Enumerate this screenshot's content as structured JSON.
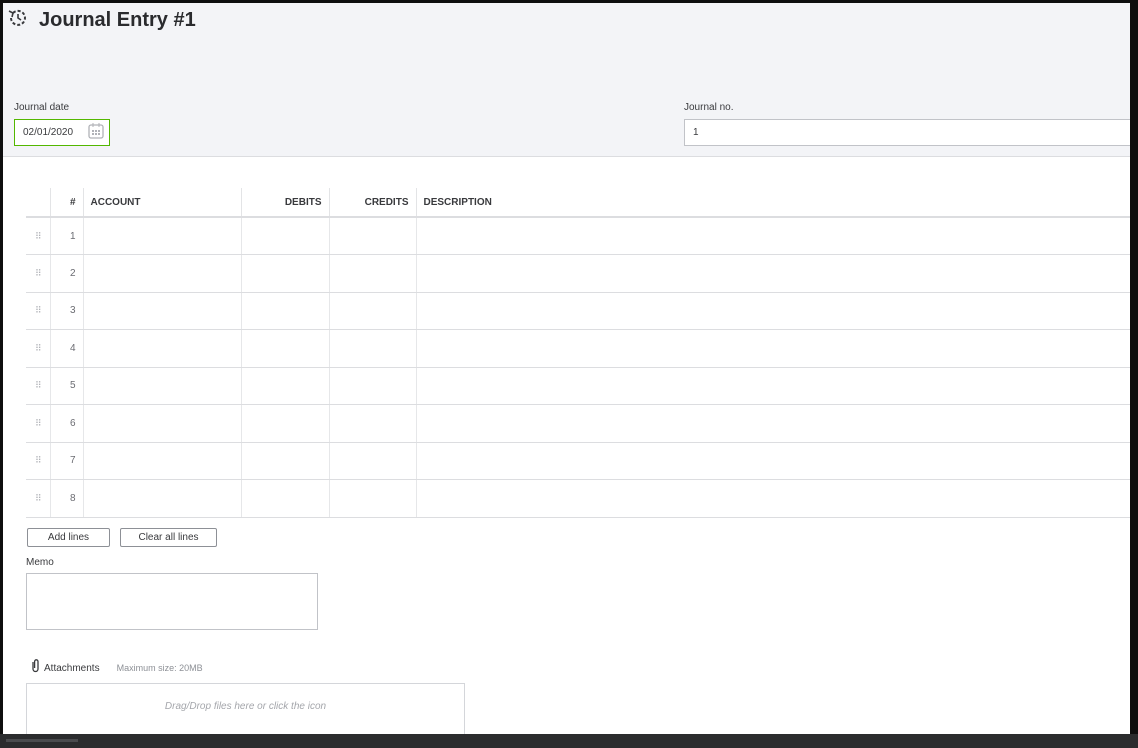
{
  "header": {
    "title": "Journal Entry #1",
    "icon": "recent-history-icon"
  },
  "journal_date": {
    "label": "Journal date",
    "value": "02/01/2020"
  },
  "journal_no": {
    "label": "Journal no.",
    "value": "1"
  },
  "table": {
    "columns": [
      "#",
      "ACCOUNT",
      "DEBITS",
      "CREDITS",
      "DESCRIPTION"
    ],
    "rows": [
      {
        "num": "1"
      },
      {
        "num": "2"
      },
      {
        "num": "3"
      },
      {
        "num": "4"
      },
      {
        "num": "5"
      },
      {
        "num": "6"
      },
      {
        "num": "7"
      },
      {
        "num": "8"
      }
    ]
  },
  "buttons": {
    "add_lines": "Add lines",
    "clear_all_lines": "Clear all lines"
  },
  "memo": {
    "label": "Memo",
    "value": ""
  },
  "attachments": {
    "label": "Attachments",
    "max_size": "Maximum size: 20MB",
    "drop_hint": "Drag/Drop files here or click the icon"
  }
}
